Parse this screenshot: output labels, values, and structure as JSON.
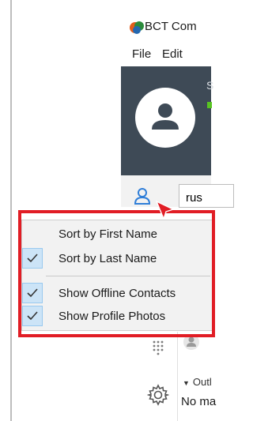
{
  "app": {
    "title": "BCT Com"
  },
  "menubar": {
    "items": [
      "File",
      "Edit"
    ]
  },
  "profile": {
    "name_fragment": "S"
  },
  "search": {
    "value": "rus"
  },
  "context_menu": {
    "items": [
      {
        "label": "Sort by First Name",
        "checked": false
      },
      {
        "label": "Sort by Last Name",
        "checked": true
      },
      {
        "label": "Show Offline Contacts",
        "checked": true
      },
      {
        "label": "Show Profile Photos",
        "checked": true
      }
    ]
  },
  "contacts": {
    "group_label": "Outl",
    "empty_text": "No ma"
  },
  "colors": {
    "profile_band": "#3e4a56",
    "highlight": "#e11d25",
    "menu_background": "#f2f2f2",
    "check_background": "#cce4f7",
    "accent": "#2f7ed8",
    "status_online": "#58c322"
  },
  "icons": {
    "logo": "bct-logo-icon",
    "avatar": "person-icon",
    "contacts": "contacts-icon",
    "cursor": "cursor-arrow-icon",
    "check": "checkmark-icon",
    "dialpad": "dialpad-icon",
    "settings": "gear-icon"
  }
}
